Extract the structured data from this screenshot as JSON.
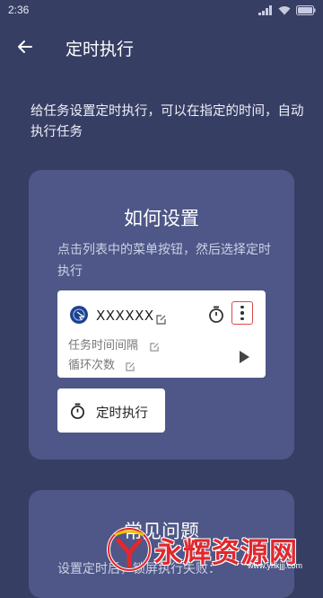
{
  "status_bar": {
    "time": "2:36"
  },
  "app_bar": {
    "title": "定时执行"
  },
  "intro": "给任务设置定时执行，可以在指定的时间，自动执行任务",
  "how_card": {
    "title": "如何设置",
    "description": "点击列表中的菜单按钮，然后选择定时执行",
    "sample_task": {
      "name": "XXXXXX",
      "interval_label": "任务时间间隔",
      "loop_label": "循环次数"
    },
    "schedule_button_label": "定时执行"
  },
  "faq_card": {
    "title": "常见问题",
    "description": "设置定时后，锁屏执行失败："
  },
  "watermark": {
    "text": "永辉资源网",
    "url": "www.yhkjjj.com"
  },
  "colors": {
    "background": "#373e64",
    "card": "#4e5787",
    "highlight": "#e04848"
  }
}
